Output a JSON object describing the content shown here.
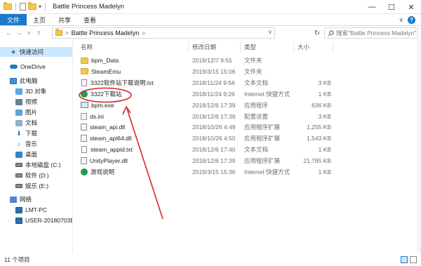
{
  "window": {
    "title": "Battle Princess Madelyn",
    "controls": {
      "minimize": "—",
      "maximize": "☐",
      "close": "✕"
    }
  },
  "ribbon": {
    "tabs": [
      "文件",
      "主页",
      "共享",
      "查看"
    ],
    "expand": "∨",
    "help": "?"
  },
  "addressbar": {
    "back": "←",
    "forward": "→",
    "recent": "∨",
    "up": "↑",
    "path": "Battle Princess Madelyn",
    "sep": ">",
    "dropdown": "∨",
    "refresh": "↻",
    "search_placeholder": "搜索\"Battle Princess Madelyn\"",
    "search_icon": "search-icon"
  },
  "sidebar": {
    "items": [
      {
        "label": "快速访问",
        "icon": "star-icon"
      },
      {
        "label": "OneDrive",
        "icon": "cloud-icon"
      },
      {
        "label": "此电脑",
        "icon": "pc-icon"
      },
      {
        "label": "3D 对象",
        "icon": "3d-objects-icon"
      },
      {
        "label": "视频",
        "icon": "video-icon"
      },
      {
        "label": "图片",
        "icon": "pictures-icon"
      },
      {
        "label": "文档",
        "icon": "documents-icon"
      },
      {
        "label": "下载",
        "icon": "downloads-icon"
      },
      {
        "label": "音乐",
        "icon": "music-icon"
      },
      {
        "label": "桌面",
        "icon": "desktop-icon"
      },
      {
        "label": "本地磁盘 (C:)",
        "icon": "drive-icon"
      },
      {
        "label": "软件 (D:)",
        "icon": "drive-icon"
      },
      {
        "label": "娱乐 (E:)",
        "icon": "drive-icon"
      },
      {
        "label": "网络",
        "icon": "network-icon"
      },
      {
        "label": "LMT-PC",
        "icon": "computer-icon"
      },
      {
        "label": "USER-20180703BF",
        "icon": "computer-icon"
      }
    ]
  },
  "columns": {
    "name": "名称",
    "modified": "修改日期",
    "type": "类型",
    "size": "大小"
  },
  "files": [
    {
      "name": "bpm_Data",
      "modified": "2018/12/7 9:55",
      "type": "文件夹",
      "size": "",
      "icon": "folder-icon"
    },
    {
      "name": "SteamEmu",
      "modified": "2019/3/15 15:06",
      "type": "文件夹",
      "size": "",
      "icon": "folder-icon"
    },
    {
      "name": "3322软件站下载说明.txt",
      "modified": "2018/11/24 9:56",
      "type": "文本文档",
      "size": "3 KB",
      "icon": "text-file-icon"
    },
    {
      "name": "3322下载站",
      "modified": "2018/11/24 9:26",
      "type": "Internet 快捷方式",
      "size": "1 KB",
      "icon": "internet-shortcut-icon"
    },
    {
      "name": "bpm.exe",
      "modified": "2018/12/6 17:39",
      "type": "应用程序",
      "size": "636 KB",
      "icon": "exe-icon"
    },
    {
      "name": "ds.ini",
      "modified": "2018/12/6 17:39",
      "type": "配置设置",
      "size": "3 KB",
      "icon": "ini-file-icon"
    },
    {
      "name": "steam_api.dll",
      "modified": "2018/10/26 4:49",
      "type": "应用程序扩展",
      "size": "1,255 KB",
      "icon": "dll-file-icon"
    },
    {
      "name": "steam_api64.dll",
      "modified": "2018/10/26 4:50",
      "type": "应用程序扩展",
      "size": "1,543 KB",
      "icon": "dll-file-icon"
    },
    {
      "name": "steam_appid.txt",
      "modified": "2018/12/6 17:40",
      "type": "文本文档",
      "size": "1 KB",
      "icon": "text-file-icon"
    },
    {
      "name": "UnityPlayer.dll",
      "modified": "2018/12/6 17:39",
      "type": "应用程序扩展",
      "size": "21,785 KB",
      "icon": "dll-file-icon"
    },
    {
      "name": "游戏说明",
      "modified": "2019/3/15 15:36",
      "type": "Internet 快捷方式",
      "size": "1 KB",
      "icon": "internet-shortcut-icon"
    }
  ],
  "status": {
    "count": "11 个项目"
  },
  "annotation": {
    "color": "#d62828",
    "highlighted_item": "bpm.exe"
  },
  "colors": {
    "accent": "#1979ca",
    "selection": "#cce8ff"
  }
}
